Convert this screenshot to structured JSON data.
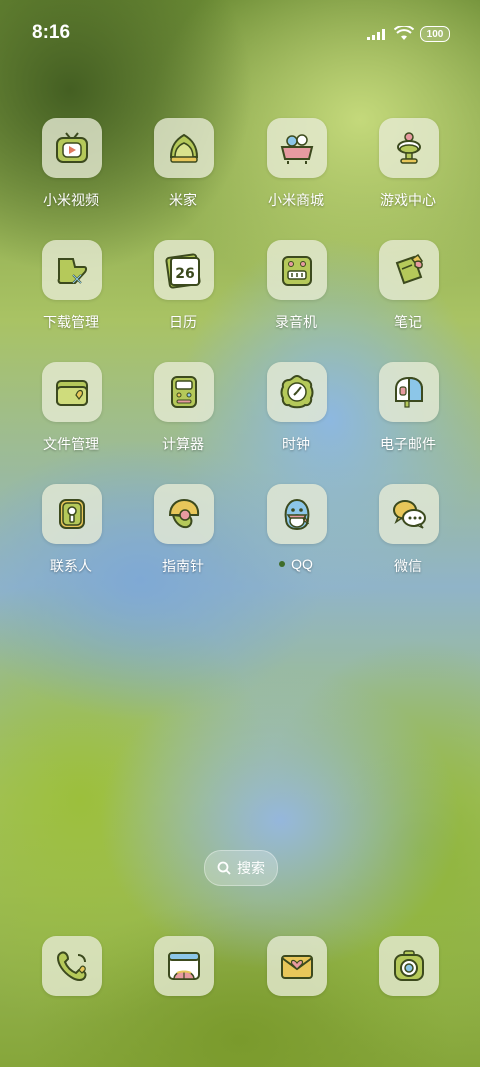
{
  "status": {
    "time": "8:16",
    "battery": "100"
  },
  "apps": [
    {
      "label": "小米视频",
      "icon": "tv-icon"
    },
    {
      "label": "米家",
      "icon": "leaf-home-icon"
    },
    {
      "label": "小米商城",
      "icon": "shopping-basket-icon"
    },
    {
      "label": "游戏中心",
      "icon": "game-trophy-icon"
    },
    {
      "label": "下载管理",
      "icon": "download-icon"
    },
    {
      "label": "日历",
      "icon": "calendar-icon",
      "day": "26"
    },
    {
      "label": "录音机",
      "icon": "recorder-icon"
    },
    {
      "label": "笔记",
      "icon": "note-icon"
    },
    {
      "label": "文件管理",
      "icon": "folder-icon"
    },
    {
      "label": "计算器",
      "icon": "calculator-icon"
    },
    {
      "label": "时钟",
      "icon": "clock-icon"
    },
    {
      "label": "电子邮件",
      "icon": "mail-house-icon"
    },
    {
      "label": "联系人",
      "icon": "contacts-icon"
    },
    {
      "label": "指南针",
      "icon": "compass-icon"
    },
    {
      "label": "QQ",
      "icon": "qq-penguin-icon"
    },
    {
      "label": "微信",
      "icon": "wechat-icon"
    }
  ],
  "search": {
    "label": "搜索",
    "icon": "search-icon"
  },
  "dock": [
    {
      "icon": "phone-icon"
    },
    {
      "icon": "browser-icon"
    },
    {
      "icon": "messages-icon"
    },
    {
      "icon": "camera-icon"
    }
  ],
  "colors": {
    "icon_green": "#b5c95a",
    "icon_outline": "#3c4a1e",
    "tile_bg": "#e8ecd6"
  }
}
